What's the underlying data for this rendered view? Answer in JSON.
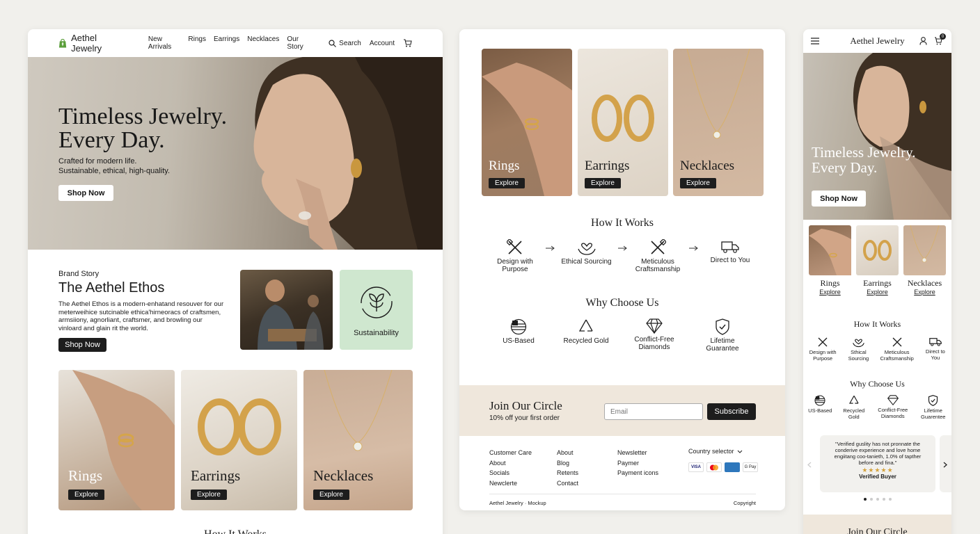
{
  "desktop": {
    "logo": "Aethel Jewelry",
    "nav_links": [
      "New Arrivals",
      "Rings",
      "Earrings",
      "Necklaces",
      "Our Story"
    ],
    "search_label": "Search",
    "account_label": "Account",
    "hero": {
      "title_line1": "Timeless Jewelry.",
      "title_line2": "Every Day.",
      "sub_line1": "Crafted for modern life.",
      "sub_line2": "Sustainable, ethical, high-quality.",
      "cta": "Shop Now"
    },
    "story": {
      "eyebrow": "Brand Story",
      "title": "The Aethel Ethos",
      "body": "The Aethel Ethos is a modern-enhatand resouver for our meterweihice sutcinable ethica'hirneoracs of craftsmen, armsiiony, agnorliant, craftsmer, and browling our vinloard and glain rit the world.",
      "cta": "Shop Now",
      "sustainability_label": "Sustainability"
    },
    "categories": [
      {
        "name": "Rings",
        "cta": "Explore"
      },
      {
        "name": "Earrings",
        "cta": "Explore"
      },
      {
        "name": "Necklaces",
        "cta": "Explore"
      }
    ],
    "next_heading_partial": "How It Works"
  },
  "tablet": {
    "categories": [
      {
        "name": "Rings",
        "cta": "Explore"
      },
      {
        "name": "Earrings",
        "cta": "Explore"
      },
      {
        "name": "Necklaces",
        "cta": "Explore"
      }
    ],
    "how_it_works": {
      "title": "How It Works",
      "steps": [
        {
          "line1": "Design with",
          "line2": "Purpose",
          "icon": "tools-icon"
        },
        {
          "line1": "Ethical Sourcing",
          "line2": "",
          "icon": "hands-heart-icon"
        },
        {
          "line1": "Meticulous",
          "line2": "Craftsmanship",
          "icon": "tools-icon"
        },
        {
          "line1": "Direct to You",
          "line2": "",
          "icon": "truck-icon"
        }
      ]
    },
    "why_choose_us": {
      "title": "Why Choose Us",
      "items": [
        {
          "line1": "US-Based",
          "line2": "",
          "icon": "flag-icon"
        },
        {
          "line1": "Recycled Gold",
          "line2": "",
          "icon": "recycle-icon"
        },
        {
          "line1": "Conflict-Free",
          "line2": "Diamonds",
          "icon": "diamond-icon"
        },
        {
          "line1": "Lifetime",
          "line2": "Guarantee",
          "icon": "shield-check-icon"
        }
      ]
    },
    "join": {
      "title": "Join Our Circle",
      "sub": "10% off your first order",
      "email_placeholder": "Email",
      "cta": "Subscribe"
    },
    "footer": {
      "col1": [
        "Customer Care",
        "About",
        "Socials",
        "Newclerte"
      ],
      "col2": [
        "About",
        "Blog",
        "Retents",
        "Contact"
      ],
      "col3": [
        "Newsletter",
        "Paymer",
        "Payment icons"
      ],
      "country_selector": "Country selector",
      "payment_icons": [
        "VISA",
        "Mastercard",
        "Amex",
        "G Pay"
      ],
      "bottom_left": "Aethel Jewelry · Mockup",
      "bottom_right": "Copyright"
    }
  },
  "mobile": {
    "logo": "Aethel Jewelry",
    "cart_count": "0",
    "hero": {
      "title_line1": "Timeless Jewelry.",
      "title_line2": "Every Day.",
      "cta": "Shop Now"
    },
    "categories": [
      {
        "name": "Rings",
        "cta": "Explore"
      },
      {
        "name": "Earrings",
        "cta": "Explore"
      },
      {
        "name": "Necklaces",
        "cta": "Explore"
      }
    ],
    "how_it_works": {
      "title": "How It Works",
      "steps": [
        {
          "line1": "Design with",
          "line2": "Purpose"
        },
        {
          "line1": "Sthical",
          "line2": "Sourcing"
        },
        {
          "line1": "Meticulous",
          "line2": "Craftsmanship"
        },
        {
          "line1": "Direct to",
          "line2": "You"
        }
      ]
    },
    "why_choose_us": {
      "title": "Why Choose Us",
      "items": [
        {
          "line1": "US-Based",
          "line2": ""
        },
        {
          "line1": "Recycled",
          "line2": "Gold"
        },
        {
          "line1": "Conflict-Free",
          "line2": "Diamonds"
        },
        {
          "line1": "Lifetime",
          "line2": "Guarentee"
        }
      ]
    },
    "testimonial": {
      "quote": "\"Verified guslity has not pronnate the conderive experience and love home engiitang coo-tanieth, 1.0% of tapther before and fina.\"",
      "stars": "★★★★★",
      "author": "Verified Buyer",
      "rating": 5
    },
    "join_partial": "Join Our Circle"
  },
  "colors": {
    "background": "#f1f0ec",
    "dark_button": "#1d1d1d",
    "sustainability_bg": "#cfe7cf",
    "join_bg": "#efe7dc",
    "star": "#d4a23c"
  }
}
